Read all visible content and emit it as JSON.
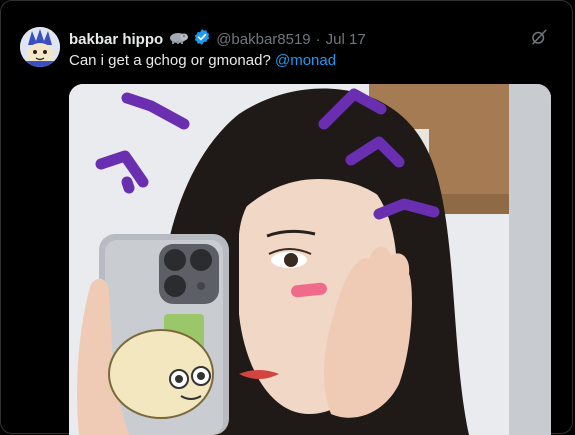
{
  "post": {
    "author_name": "bakbar hippo",
    "author_handle": "@bakbar8519",
    "separator": "·",
    "date": "Jul 17",
    "text_prefix": "Can i get a gchog or gmonad? ",
    "mention": "@monad"
  },
  "icons": {
    "emoji": "hippo-emoji-icon",
    "verified": "verified-badge-icon",
    "grok": "grok-icon"
  },
  "colors": {
    "background": "#000000",
    "text": "#e7e9ea",
    "muted": "#71767b",
    "link": "#1d9bf0",
    "doodle": "#6a2fb0"
  }
}
